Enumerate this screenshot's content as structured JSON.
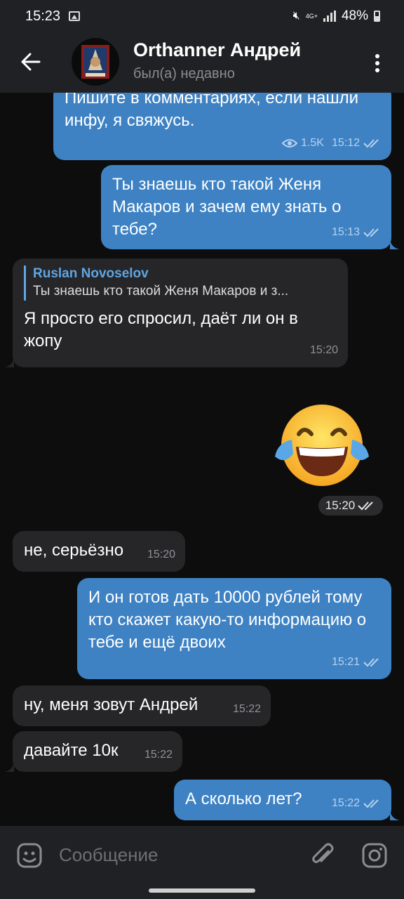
{
  "status_bar": {
    "time": "15:23",
    "network": "4G+",
    "battery": "48%"
  },
  "header": {
    "name": "Orthanner Андрей",
    "status": "был(а) недавно"
  },
  "messages": [
    {
      "text": "Пишите в комментариях, если нашли инфу, я свяжусь.",
      "views": "1.5K",
      "time": "15:12"
    },
    {
      "text": "Ты знаешь кто такой Женя Макаров и зачем ему знать о тебе?",
      "time": "15:13"
    },
    {
      "reply_name": "Ruslan Novoselov",
      "reply_text": "Ты знаешь кто такой Женя Макаров и з...",
      "text": "Я просто его спросил, даёт ли он в жопу",
      "time": "15:20"
    },
    {
      "emoji": "😂",
      "time": "15:20"
    },
    {
      "text": "не, серьёзно",
      "time": "15:20"
    },
    {
      "text": "И он готов дать 10000 рублей тому кто скажет какую-то информацию о тебе и ещё двоих",
      "time": "15:21"
    },
    {
      "text": "ну, меня зовут Андрей",
      "time": "15:22"
    },
    {
      "text": "давайте 10к",
      "time": "15:22"
    },
    {
      "text": "А сколько лет?",
      "time": "15:22"
    }
  ],
  "composer": {
    "placeholder": "Сообщение"
  },
  "colors": {
    "outgoing_bubble": "#3e82c4",
    "incoming_bubble": "#262628",
    "accent": "#5ea6e5",
    "background": "#0d0d0d"
  }
}
